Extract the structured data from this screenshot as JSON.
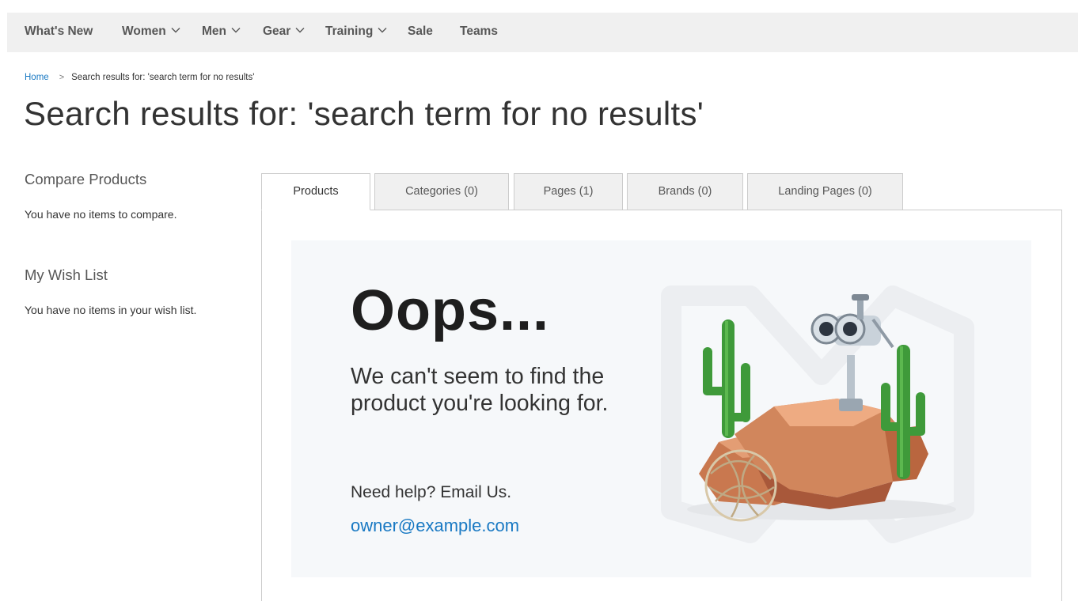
{
  "nav": {
    "items": [
      {
        "label": "What's New",
        "has_dropdown": false
      },
      {
        "label": "Women",
        "has_dropdown": true
      },
      {
        "label": "Men",
        "has_dropdown": true
      },
      {
        "label": "Gear",
        "has_dropdown": true
      },
      {
        "label": "Training",
        "has_dropdown": true
      },
      {
        "label": "Sale",
        "has_dropdown": false
      },
      {
        "label": "Teams",
        "has_dropdown": false
      }
    ]
  },
  "breadcrumb": {
    "home": "Home",
    "separator": ">",
    "current": "Search results for: 'search term for no results'"
  },
  "page_title": "Search results for: 'search term for no results'",
  "sidebar": {
    "compare_heading": "Compare Products",
    "compare_empty": "You have no items to compare.",
    "wishlist_heading": "My Wish List",
    "wishlist_empty": "You have no items in your wish list."
  },
  "tabs": [
    {
      "label": "Products",
      "active": true
    },
    {
      "label": "Categories (0)",
      "active": false
    },
    {
      "label": "Pages (1)",
      "active": false
    },
    {
      "label": "Brands (0)",
      "active": false
    },
    {
      "label": "Landing Pages (0)",
      "active": false
    }
  ],
  "no_results": {
    "heading": "Oops...",
    "message": "We can't seem to find the product you're looking for.",
    "help_text": "Need help? Email Us.",
    "email": "owner@example.com",
    "illustration": "desert-binoculars-illustration"
  },
  "colors": {
    "link": "#1979c3",
    "nav_bg": "#f0f0f0",
    "card_bg": "#f6f8fa",
    "tab_border": "#cccccc"
  }
}
